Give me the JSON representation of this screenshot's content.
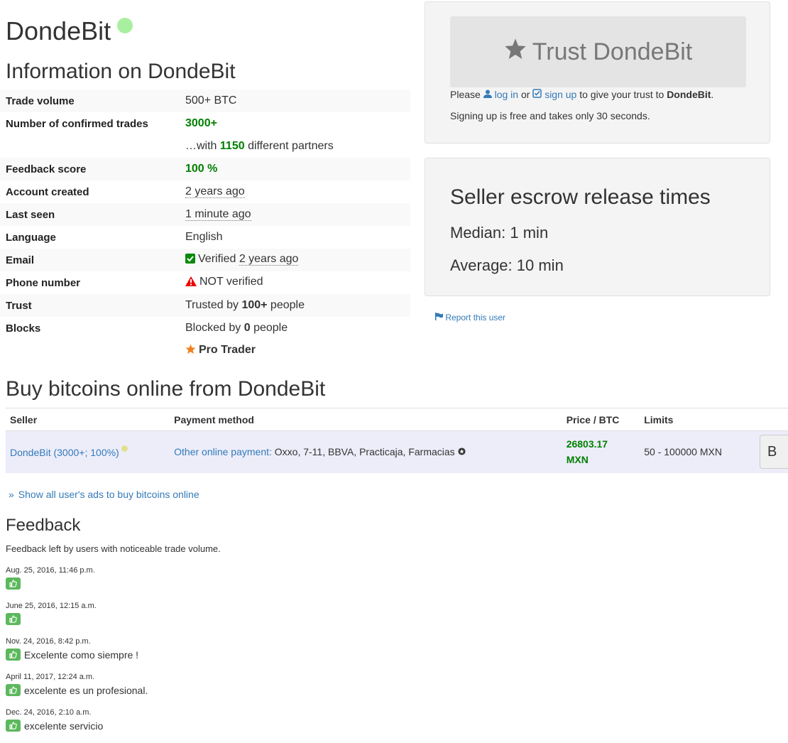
{
  "user": {
    "name": "DondeBit",
    "online_status": "online",
    "online_color": "#a8f0a0"
  },
  "info": {
    "heading": "Information on DondeBit",
    "rows": [
      {
        "label": "Trade volume",
        "value": "500+ BTC"
      },
      {
        "label": "Number of confirmed trades",
        "value": "3000+"
      },
      {
        "label": "",
        "prefix": "…with ",
        "value": "1150",
        "suffix": " different partners"
      },
      {
        "label": "Feedback score",
        "value": "100 %"
      },
      {
        "label": "Account created",
        "value": "2 years ago"
      },
      {
        "label": "Last seen",
        "value": "1 minute ago"
      },
      {
        "label": "Language",
        "value": "English"
      },
      {
        "label": "Email",
        "icon": "check-square-icon",
        "prefix": "Verified ",
        "value": "2 years ago"
      },
      {
        "label": "Phone number",
        "icon": "warning-icon",
        "value": "NOT verified"
      },
      {
        "label": "Trust",
        "prefix": "Trusted by ",
        "value": "100+",
        "suffix": " people"
      },
      {
        "label": "Blocks",
        "prefix": "Blocked by ",
        "value": "0",
        "suffix": " people"
      },
      {
        "label": "",
        "icon": "star-badge-icon",
        "value": "Pro Trader"
      }
    ]
  },
  "trust_panel": {
    "button_label": "Trust DondeBit",
    "button_icon": "star-icon",
    "text_please": "Please ",
    "login_label": "log in",
    "text_or": " or ",
    "signup_label": "sign up",
    "text_give": " to give your trust to ",
    "text_name": "DondeBit",
    "text_end": ".",
    "subtext": "Signing up is free and takes only 30 seconds."
  },
  "escrow_panel": {
    "title": "Seller escrow release times",
    "median": "Median: 1 min",
    "average": "Average: 10 min"
  },
  "report_link": "Report this user",
  "buy_section": {
    "heading": "Buy bitcoins online from DondeBit",
    "columns": [
      "Seller",
      "Payment method",
      "Price / BTC",
      "Limits",
      ""
    ],
    "ads": [
      {
        "seller": "DondeBit (3000+; 100%)",
        "payment_method": "Other online payment:",
        "payment_details": " Oxxo, 7-11, BBVA, Practicaja, Farmacias",
        "price_line1": "26803.17",
        "price_line2": "MXN",
        "limits": "50 - 100000 MXN",
        "button_label": "B"
      }
    ],
    "show_all": "Show all user's ads to buy bitcoins online"
  },
  "feedback": {
    "heading": "Feedback",
    "description": "Feedback left by users with noticeable trade volume.",
    "items": [
      {
        "date": "Aug. 25, 2016, 11:46 p.m.",
        "type": "positive",
        "text": ""
      },
      {
        "date": "June 25, 2016, 12:15 a.m.",
        "type": "positive",
        "text": ""
      },
      {
        "date": "Nov. 24, 2016, 8:42 p.m.",
        "type": "positive",
        "text": "Excelente como siempre !"
      },
      {
        "date": "April 11, 2017, 12:24 a.m.",
        "type": "positive",
        "text": "excelente es un profesional."
      },
      {
        "date": "Dec. 24, 2016, 2:10 a.m.",
        "type": "positive",
        "text": "excelente servicio"
      }
    ]
  }
}
